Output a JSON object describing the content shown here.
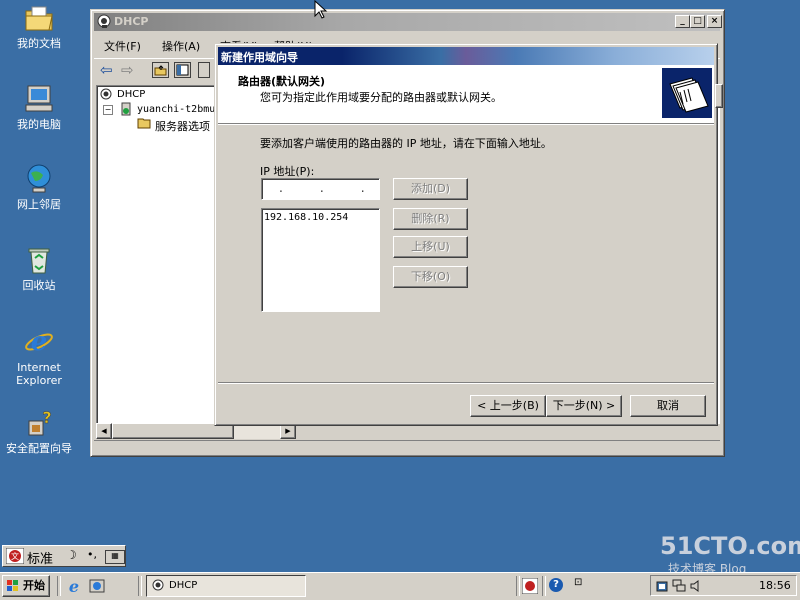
{
  "desktop": {
    "icons": [
      {
        "label": "我的文档"
      },
      {
        "label": "我的电脑"
      },
      {
        "label": "网上邻居"
      },
      {
        "label": "回收站"
      },
      {
        "label": "Internet Explorer"
      },
      {
        "label": "安全配置向导"
      }
    ]
  },
  "dhcp_window": {
    "title": "DHCP",
    "menu": [
      "文件(F)",
      "操作(A)",
      "查看(V)",
      "帮助(H)"
    ],
    "tree": {
      "root": "DHCP",
      "server": "yuanchi-t2bmu",
      "node": "服务器选项"
    },
    "controls": {
      "minimize": "_",
      "maximize": "□",
      "close": "×"
    }
  },
  "wizard": {
    "title": "新建作用域向导",
    "header_title": "路由器(默认网关)",
    "header_subtitle": "您可为指定此作用域要分配的路由器或默认网关。",
    "instruction": "要添加客户端使用的路由器的 IP 地址，请在下面输入地址。",
    "ip_label": "IP 地址(P):",
    "ip_placeholder": " .  .  . ",
    "ip_list": [
      "192.168.10.254"
    ],
    "buttons": {
      "add": "添加(D)",
      "remove": "删除(R)",
      "up": "上移(U)",
      "down": "下移(O)",
      "back": "< 上一步(B)",
      "next": "下一步(N) >",
      "cancel": "取消"
    }
  },
  "ime": {
    "label": "标准"
  },
  "taskbar": {
    "start": "开始",
    "task": "DHCP",
    "clock": "18:56"
  },
  "watermark": {
    "line1": "51CTO.com",
    "line2": "技术博客 Blog"
  }
}
